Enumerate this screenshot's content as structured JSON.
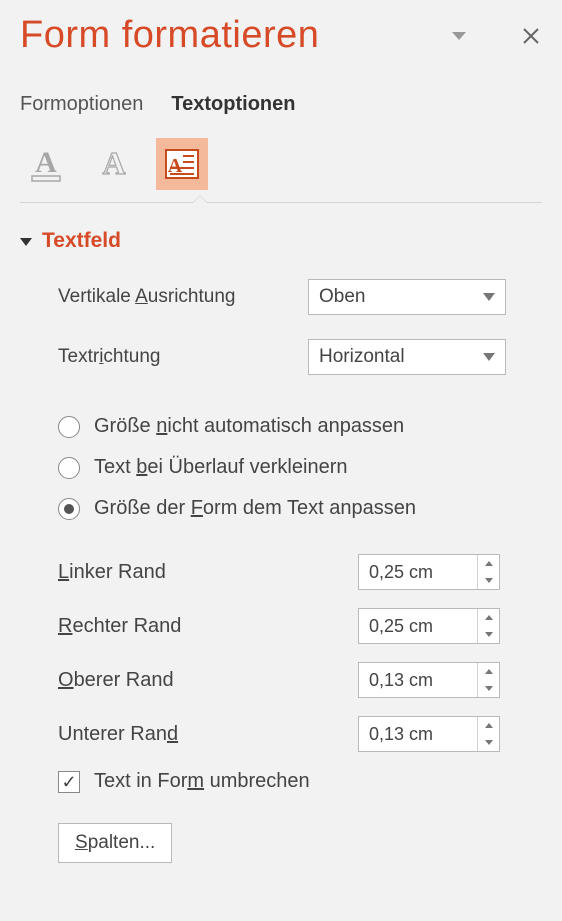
{
  "pane": {
    "title": "Form formatieren"
  },
  "tabs": {
    "shape": "Formoptionen",
    "text": "Textoptionen"
  },
  "section": {
    "title": "Textfeld"
  },
  "valign": {
    "label_pre": "Vertikale ",
    "label_u": "A",
    "label_post": "usrichtung",
    "value": "Oben"
  },
  "tdir": {
    "label_pre": "Textr",
    "label_u": "i",
    "label_post": "chtung",
    "value": "Horizontal"
  },
  "autofit": {
    "none_pre": "Größe ",
    "none_u": "n",
    "none_post": "icht automatisch anpassen",
    "shrink_pre": "Text ",
    "shrink_u": "b",
    "shrink_post": "ei Überlauf verkleinern",
    "resize_pre": "Größe der ",
    "resize_u": "F",
    "resize_post": "orm dem Text anpassen"
  },
  "margins": {
    "left_u": "L",
    "left_post": "inker Rand",
    "left_val": "0,25 cm",
    "right_u": "R",
    "right_post": "echter Rand",
    "right_val": "0,25 cm",
    "top_u": "O",
    "top_post": "berer Rand",
    "top_val": "0,13 cm",
    "bottom_pre": "Unterer Ran",
    "bottom_u": "d",
    "bottom_val": "0,13 cm"
  },
  "wrap": {
    "pre": "Text in For",
    "u": "m",
    "post": " umbrechen"
  },
  "columns": {
    "u": "S",
    "post": "palten..."
  }
}
